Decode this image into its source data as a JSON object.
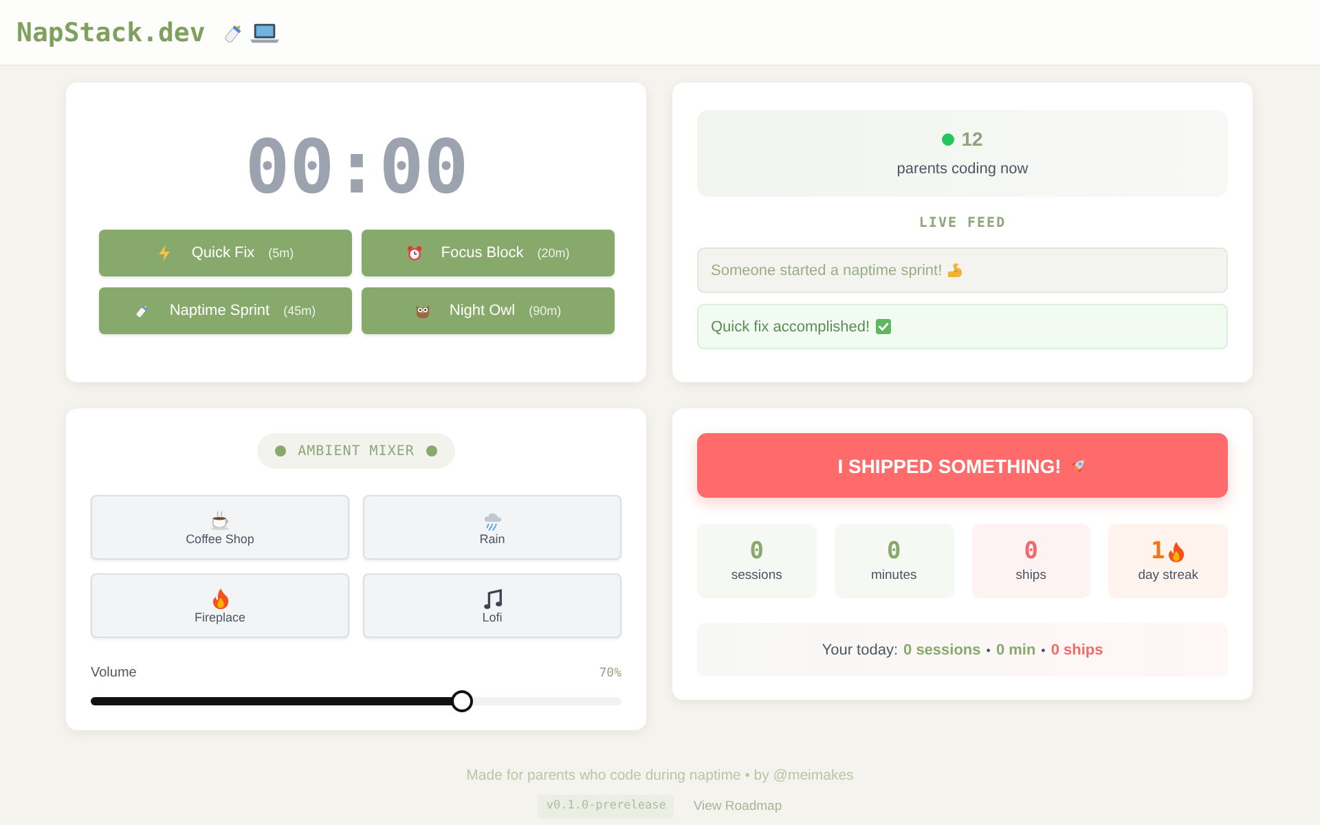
{
  "header": {
    "logo": "NapStack.dev"
  },
  "timer": {
    "display": "00:00",
    "presets": [
      {
        "label": "Quick Fix",
        "duration": "(5m)"
      },
      {
        "label": "Focus Block",
        "duration": "(20m)"
      },
      {
        "label": "Naptime Sprint",
        "duration": "(45m)"
      },
      {
        "label": "Night Owl",
        "duration": "(90m)"
      }
    ]
  },
  "community": {
    "count": "12",
    "caption": "parents coding now",
    "feed_title": "LIVE FEED",
    "feed": [
      {
        "kind": "info",
        "text": "Someone started a naptime sprint!"
      },
      {
        "kind": "success",
        "text": "Quick fix accomplished!"
      }
    ]
  },
  "mixer": {
    "title": "AMBIENT MIXER",
    "sounds": [
      {
        "label": "Coffee Shop",
        "selected": false
      },
      {
        "label": "Rain",
        "selected": false
      },
      {
        "label": "Fireplace",
        "selected": false
      },
      {
        "label": "Lofi",
        "selected": false
      }
    ],
    "volume": {
      "label": "Volume",
      "reading": "70%",
      "level": 0.7
    }
  },
  "progress": {
    "ship_button": "I SHIPPED SOMETHING!",
    "stats": [
      {
        "kind": "count",
        "value": "0",
        "label": "sessions",
        "color": "#87a96b"
      },
      {
        "kind": "count",
        "value": "0",
        "label": "minutes",
        "color": "#87a96b"
      },
      {
        "kind": "count",
        "value": "0",
        "label": "ships",
        "color": "#f26b6b"
      },
      {
        "kind": "streak",
        "value": "1",
        "label": "day streak",
        "color": "#f97316"
      }
    ],
    "summary": [
      {
        "kind": "lead",
        "text": "Your today:"
      },
      {
        "kind": "value",
        "text": "0 sessions",
        "color": "#87a96b"
      },
      {
        "kind": "sep",
        "text": "•"
      },
      {
        "kind": "value",
        "text": "0 min",
        "color": "#87a96b"
      },
      {
        "kind": "sep",
        "text": "•"
      },
      {
        "kind": "value",
        "text": "0 ships",
        "color": "#f26b6b"
      }
    ]
  },
  "footer": {
    "credit": "Made for parents who code during naptime • by @meimakes",
    "version": "v0.1.0-prerelease",
    "link": "View Roadmap"
  }
}
